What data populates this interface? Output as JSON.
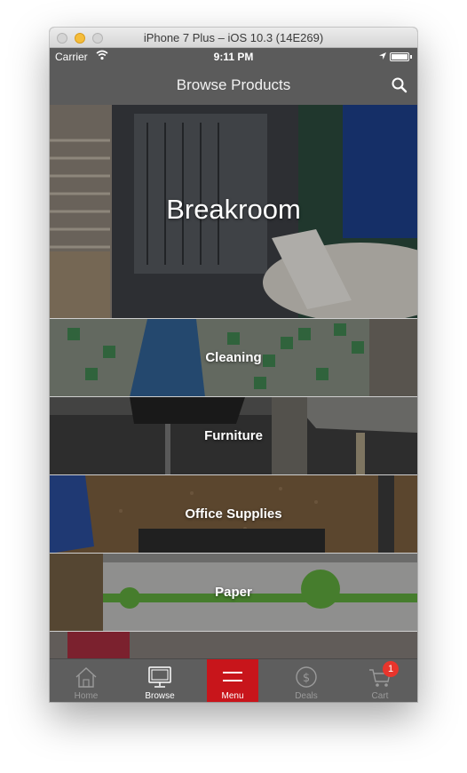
{
  "window": {
    "title": "iPhone 7 Plus – iOS 10.3 (14E269)"
  },
  "status_bar": {
    "carrier": "Carrier",
    "time": "9:11 PM",
    "icons": [
      "wifi-icon",
      "location-arrow-icon",
      "battery-icon"
    ]
  },
  "nav": {
    "title": "Browse Products",
    "search_icon": "search-icon"
  },
  "categories": [
    {
      "label": "Breakroom"
    },
    {
      "label": "Cleaning"
    },
    {
      "label": "Furniture"
    },
    {
      "label": "Office Supplies"
    },
    {
      "label": "Paper"
    }
  ],
  "tabs": [
    {
      "label": "Home",
      "icon": "home-icon"
    },
    {
      "label": "Browse",
      "icon": "monitor-icon",
      "active": true
    },
    {
      "label": "Menu",
      "icon": "hamburger-menu-icon"
    },
    {
      "label": "Deals",
      "icon": "dollar-coin-icon"
    },
    {
      "label": "Cart",
      "icon": "cart-icon",
      "badge": "1"
    }
  ],
  "colors": {
    "accent": "#c8151b",
    "bar": "#5b5b5b",
    "badge": "#e8352c"
  }
}
